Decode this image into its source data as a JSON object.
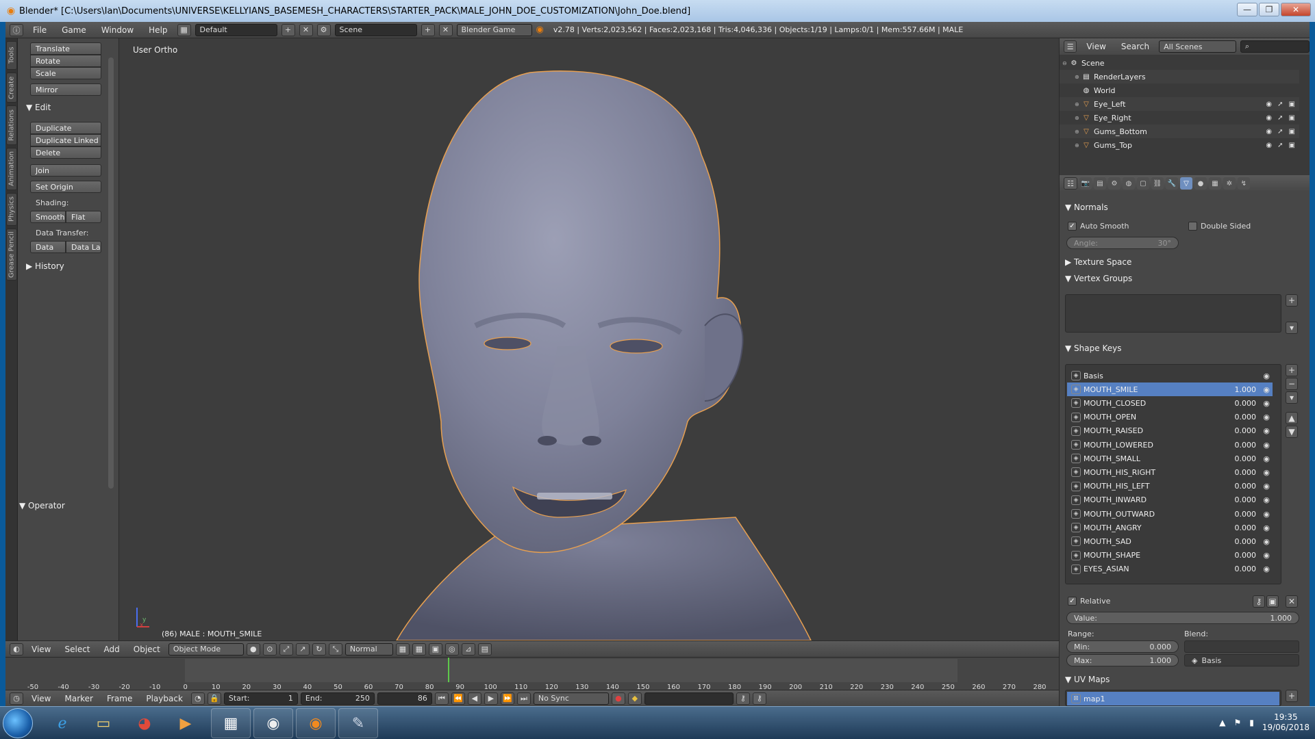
{
  "window": {
    "title": "Blender* [C:\\Users\\Ian\\Documents\\UNIVERSE\\KELLYIANS_BASEMESH_CHARACTERS\\STARTER_PACK\\MALE_JOHN_DOE_CUSTOMIZATION\\John_Doe.blend]",
    "min": "—",
    "max": "❐",
    "close": "✕"
  },
  "menu": {
    "file": "File",
    "game": "Game",
    "window": "Window",
    "help": "Help",
    "layout": "Default",
    "scene": "Scene",
    "engine": "Blender Game",
    "stats": "v2.78 | Verts:2,023,562 | Faces:2,023,168 | Tris:4,046,336 | Objects:1/19 | Lamps:0/1 | Mem:557.66M | MALE"
  },
  "vertical_tabs": [
    "Tools",
    "Create",
    "Relations",
    "Animation",
    "Physics",
    "Grease Pencil"
  ],
  "toolshelf": {
    "translate": "Translate",
    "rotate": "Rotate",
    "scale": "Scale",
    "mirror": "Mirror",
    "edit_header": "Edit",
    "duplicate": "Duplicate",
    "duplicate_linked": "Duplicate Linked",
    "delete": "Delete",
    "join": "Join",
    "set_origin": "Set Origin",
    "shading_label": "Shading:",
    "smooth": "Smooth",
    "flat": "Flat",
    "data_transfer_label": "Data Transfer:",
    "data": "Data",
    "data_layout": "Data La",
    "history": "History",
    "operator": "Operator"
  },
  "viewport": {
    "view_label": "User Ortho",
    "status": "(86) MALE : MOUTH_SMILE",
    "axis_x": "x",
    "axis_y": "y"
  },
  "view3d_header": {
    "view": "View",
    "select": "Select",
    "add": "Add",
    "object": "Object",
    "mode": "Object Mode",
    "orientation": "Normal"
  },
  "timeline": {
    "ticks": [
      "-50",
      "-40",
      "-30",
      "-20",
      "-10",
      "0",
      "10",
      "20",
      "30",
      "40",
      "50",
      "60",
      "70",
      "80",
      "90",
      "100",
      "110",
      "120",
      "130",
      "140",
      "150",
      "160",
      "170",
      "180",
      "190",
      "200",
      "210",
      "220",
      "230",
      "240",
      "250",
      "260",
      "270",
      "280"
    ],
    "current_frame": 86,
    "header": {
      "view": "View",
      "marker": "Marker",
      "frame": "Frame",
      "playback": "Playback",
      "start_label": "Start:",
      "start": "1",
      "end_label": "End:",
      "end": "250",
      "current": "86",
      "sync": "No Sync"
    }
  },
  "outliner": {
    "view": "View",
    "search": "Search",
    "filter": "All Scenes",
    "items": [
      {
        "label": "Scene",
        "icon": "scene-icon"
      },
      {
        "label": "RenderLayers",
        "icon": "renderlayers-icon"
      },
      {
        "label": "World",
        "icon": "world-icon"
      },
      {
        "label": "Eye_Left",
        "icon": "mesh-icon"
      },
      {
        "label": "Eye_Right",
        "icon": "mesh-icon"
      },
      {
        "label": "Gums_Bottom",
        "icon": "mesh-icon"
      },
      {
        "label": "Gums_Top",
        "icon": "mesh-icon"
      }
    ]
  },
  "properties": {
    "normals": {
      "header": "Normals",
      "auto_smooth": "Auto Smooth",
      "auto_smooth_checked": true,
      "double_sided": "Double Sided",
      "double_sided_checked": false,
      "angle_label": "Angle:",
      "angle_value": "30°"
    },
    "texture_space": "Texture Space",
    "vertex_groups": "Vertex Groups",
    "shape_keys": {
      "header": "Shape Keys",
      "items": [
        {
          "name": "Basis",
          "value": ""
        },
        {
          "name": "MOUTH_SMILE",
          "value": "1.000",
          "selected": true
        },
        {
          "name": "MOUTH_CLOSED",
          "value": "0.000"
        },
        {
          "name": "MOUTH_OPEN",
          "value": "0.000"
        },
        {
          "name": "MOUTH_RAISED",
          "value": "0.000"
        },
        {
          "name": "MOUTH_LOWERED",
          "value": "0.000"
        },
        {
          "name": "MOUTH_SMALL",
          "value": "0.000"
        },
        {
          "name": "MOUTH_HIS_RIGHT",
          "value": "0.000"
        },
        {
          "name": "MOUTH_HIS_LEFT",
          "value": "0.000"
        },
        {
          "name": "MOUTH_INWARD",
          "value": "0.000"
        },
        {
          "name": "MOUTH_OUTWARD",
          "value": "0.000"
        },
        {
          "name": "MOUTH_ANGRY",
          "value": "0.000"
        },
        {
          "name": "MOUTH_SAD",
          "value": "0.000"
        },
        {
          "name": "MOUTH_SHAPE",
          "value": "0.000"
        },
        {
          "name": "EYES_ASIAN",
          "value": "0.000"
        }
      ],
      "relative": "Relative",
      "relative_checked": true,
      "value_label": "Value:",
      "value": "1.000",
      "range_label": "Range:",
      "blend_label": "Blend:",
      "min_label": "Min:",
      "min_value": "0.000",
      "max_label": "Max:",
      "max_value": "1.000",
      "blend_value": "Basis"
    },
    "uv_maps": {
      "header": "UV Maps",
      "items": [
        "map1"
      ]
    }
  },
  "taskbar": {
    "apps": [
      "start-orb",
      "internet-explorer-icon",
      "file-explorer-icon",
      "chrome-icon",
      "media-player-icon",
      "app-icon",
      "obs-icon",
      "blender-icon",
      "paint-icon"
    ],
    "time": "19:35",
    "date": "19/06/2018"
  },
  "colors": {
    "accent_blue": "#5680c2",
    "selection_outline": "#e8a050",
    "current_frame": "#5ec84a"
  }
}
